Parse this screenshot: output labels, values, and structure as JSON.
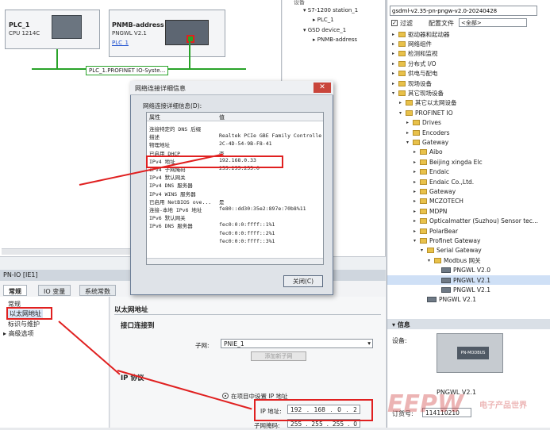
{
  "network": {
    "plc": {
      "name": "PLC_1",
      "model": "CPU 1214C"
    },
    "pnmb": {
      "name": "PNMB-address",
      "model": "PNGWL V2.1",
      "link": "PLC_1"
    },
    "subnet_label": "PLC_1.PROFINET IO-Syste..."
  },
  "project_tree": {
    "top_item": "设备",
    "items": [
      "S7-1200 station_1",
      "PLC_1",
      "GSD device_1",
      "PNMB-address"
    ]
  },
  "catalog": {
    "search_value": "gsdml-v2.35-pn-pngw-v2.0-20240428",
    "filter_label": "过滤",
    "profile_label": "配置文件",
    "profile_value": "<全部>",
    "items": [
      {
        "label": "驱动器和起动器",
        "level": 0,
        "kind": "folder",
        "arrow": "▸"
      },
      {
        "label": "网络组件",
        "level": 0,
        "kind": "folder",
        "arrow": "▸"
      },
      {
        "label": "检测和监视",
        "level": 0,
        "kind": "folder",
        "arrow": "▸"
      },
      {
        "label": "分布式 I/O",
        "level": 0,
        "kind": "folder",
        "arrow": "▸"
      },
      {
        "label": "供电与配电",
        "level": 0,
        "kind": "folder",
        "arrow": "▸"
      },
      {
        "label": "现场设备",
        "level": 0,
        "kind": "folder",
        "arrow": "▸"
      },
      {
        "label": "其它现场设备",
        "level": 0,
        "kind": "folder",
        "arrow": "▾"
      },
      {
        "label": "其它以太网设备",
        "level": 1,
        "kind": "folder",
        "arrow": "▸"
      },
      {
        "label": "PROFINET IO",
        "level": 1,
        "kind": "folder",
        "arrow": "▾"
      },
      {
        "label": "Drives",
        "level": 2,
        "kind": "folder",
        "arrow": "▸"
      },
      {
        "label": "Encoders",
        "level": 2,
        "kind": "folder",
        "arrow": "▸"
      },
      {
        "label": "Gateway",
        "level": 2,
        "kind": "folder",
        "arrow": "▾"
      },
      {
        "label": "Aibo",
        "level": 3,
        "kind": "folder",
        "arrow": "▸"
      },
      {
        "label": "Beijing xingda Elc",
        "level": 3,
        "kind": "folder",
        "arrow": "▸"
      },
      {
        "label": "Endaic",
        "level": 3,
        "kind": "folder",
        "arrow": "▸"
      },
      {
        "label": "Endaic Co.,Ltd.",
        "level": 3,
        "kind": "folder",
        "arrow": "▸"
      },
      {
        "label": "Gateway",
        "level": 3,
        "kind": "folder",
        "arrow": "▸"
      },
      {
        "label": "MCZOTECH",
        "level": 3,
        "kind": "folder",
        "arrow": "▸"
      },
      {
        "label": "MDPN",
        "level": 3,
        "kind": "folder",
        "arrow": "▸"
      },
      {
        "label": "Opticalmatter (Suzhou) Sensor tec...",
        "level": 3,
        "kind": "folder",
        "arrow": "▸"
      },
      {
        "label": "PolarBear",
        "level": 3,
        "kind": "folder",
        "arrow": "▸"
      },
      {
        "label": "Profinet Gateway",
        "level": 3,
        "kind": "folder",
        "arrow": "▾"
      },
      {
        "label": "Serial Gateway",
        "level": 4,
        "kind": "folder",
        "arrow": "▾"
      },
      {
        "label": "Modbus 网关",
        "level": 5,
        "kind": "folder",
        "arrow": "▾"
      },
      {
        "label": "PNGWL V2.0",
        "level": 6,
        "kind": "device",
        "arrow": ""
      },
      {
        "label": "PNGWL V2.1",
        "level": 6,
        "kind": "device",
        "arrow": "",
        "selected": true
      },
      {
        "label": "PNGWL V2.1",
        "level": 6,
        "kind": "device",
        "arrow": ""
      },
      {
        "label": "PNGWL V2.1",
        "level": 4,
        "kind": "device",
        "arrow": ""
      }
    ]
  },
  "info": {
    "title": "信息",
    "device_label": "设备:",
    "device_name": "PNGWL V2.1",
    "order_label": "订货号:",
    "order_value": "114110210"
  },
  "props": {
    "title": "PN-IO [IE1]",
    "tabs": [
      "常规",
      "IO 变量",
      "系统常数"
    ],
    "nav": [
      "常规",
      "以太网地址",
      "标识与维护",
      "高级选项"
    ],
    "section_ethernet": "以太网地址",
    "section_interface": "接口连接到",
    "subnet_label": "子网:",
    "subnet_value": "PNIE_1",
    "add_subnet": "添加新子网",
    "section_ip": "IP 协议",
    "radio_label": "在项目中设置 IP 地址",
    "ip_label": "IP 地址:",
    "ip_value": [
      "192",
      "168",
      "0",
      "2"
    ],
    "mask_label": "子网掩码:",
    "mask_value": [
      "255",
      "255",
      "255",
      "0"
    ]
  },
  "dialog": {
    "title": "网络连接详细信息",
    "subtitle": "网络连接详细信息(D):",
    "col_prop": "属性",
    "col_val": "值",
    "rows": [
      {
        "k": "连接特定的 DNS 后缀",
        "v": ""
      },
      {
        "k": "描述",
        "v": "Realtek PCIe GBE Family Controlle"
      },
      {
        "k": "物理地址",
        "v": "2C-4D-54-9B-F8-41"
      },
      {
        "k": "已启用 DHCP",
        "v": "否"
      },
      {
        "k": "IPv4 地址",
        "v": "192.168.0.33"
      },
      {
        "k": "IPv4 子网掩码",
        "v": "255.255.255.0"
      },
      {
        "k": "IPv4 默认网关",
        "v": ""
      },
      {
        "k": "IPv4 DNS 服务器",
        "v": ""
      },
      {
        "k": "IPv4 WINS 服务器",
        "v": ""
      },
      {
        "k": "已启用 NetBIOS ove...",
        "v": "是"
      },
      {
        "k": "连接-本地 IPv6 地址",
        "v": "fe80::dd30:35e2:897e:70b8%11"
      },
      {
        "k": "IPv6 默认网关",
        "v": ""
      },
      {
        "k": "IPv6 DNS 服务器",
        "v": "fec0:0:0:ffff::1%1"
      },
      {
        "k": "",
        "v": "fec0:0:0:ffff::2%1"
      },
      {
        "k": "",
        "v": "fec0:0:0:ffff::3%1"
      }
    ],
    "close_button": "关闭(C)"
  },
  "watermark": {
    "brand": "EEPW",
    "cn": "电子产品世界"
  },
  "colors": {
    "highlight": "#e02020",
    "profinet": "#29a329"
  }
}
